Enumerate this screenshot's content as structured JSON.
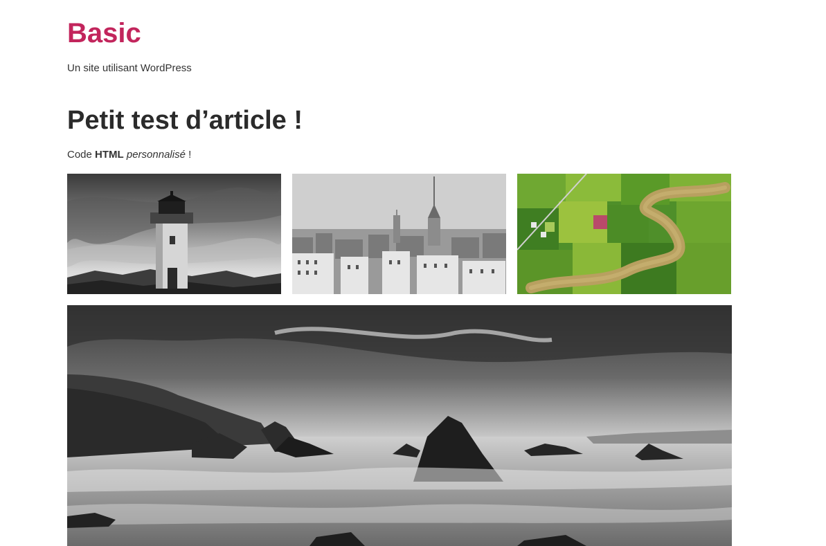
{
  "site": {
    "title": "Basic",
    "tagline": "Un site utilisant WordPress",
    "accent_color": "#c2255c"
  },
  "post": {
    "title": "Petit test d’article !",
    "intro": {
      "prefix": "Code ",
      "bold": "HTML",
      "space": " ",
      "italic": "personnalisé",
      "suffix": " !"
    }
  },
  "gallery": {
    "images": [
      {
        "subject": "lighthouse",
        "style": "black-and-white"
      },
      {
        "subject": "city-skyline",
        "style": "black-and-white"
      },
      {
        "subject": "aerial-river-fields",
        "style": "color"
      }
    ],
    "hero": {
      "subject": "rocky-seascape",
      "style": "black-and-white"
    }
  }
}
